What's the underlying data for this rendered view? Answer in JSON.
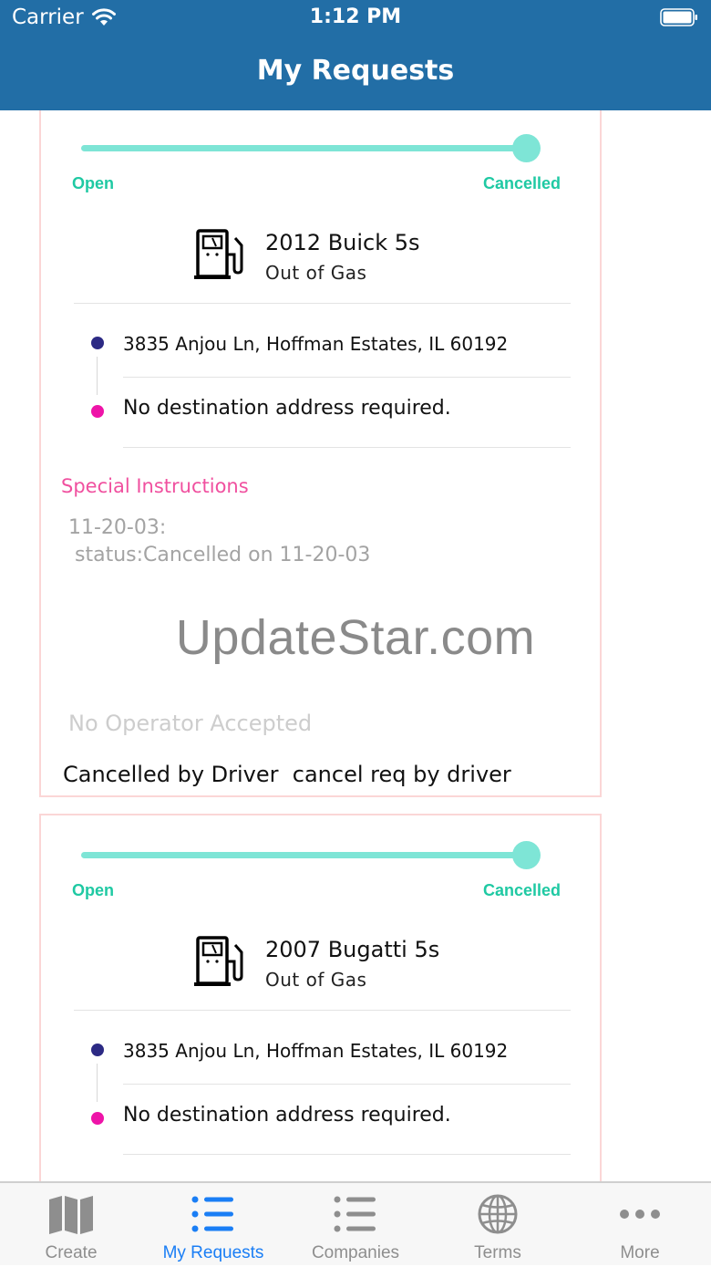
{
  "status_bar": {
    "carrier": "Carrier",
    "time": "1:12 PM"
  },
  "nav": {
    "title": "My Requests"
  },
  "requests": [
    {
      "stage_start": "Open",
      "stage_end": "Cancelled",
      "vehicle": "2012 Buick 5s",
      "service": "Out of Gas",
      "pickup_address": "3835 Anjou Ln, Hoffman Estates, IL 60192",
      "destination": "No destination address required.",
      "special_instructions_label": "Special Instructions",
      "special_instructions": "11-20-03:\n status:Cancelled on 11-20-03",
      "operator_status": "No Operator Accepted",
      "cancel_note": "Cancelled by Driver  cancel req by driver"
    },
    {
      "stage_start": "Open",
      "stage_end": "Cancelled",
      "vehicle": "2007 Bugatti 5s",
      "service": "Out of Gas",
      "pickup_address": "3835 Anjou Ln, Hoffman Estates, IL 60192",
      "destination": "No destination address required."
    }
  ],
  "watermark": "UpdateStar.com",
  "tabs": [
    {
      "label": "Create",
      "icon": "map-icon"
    },
    {
      "label": "My Requests",
      "icon": "list-icon",
      "active": true
    },
    {
      "label": "Companies",
      "icon": "list-icon"
    },
    {
      "label": "Terms",
      "icon": "globe-icon"
    },
    {
      "label": "More",
      "icon": "more-icon"
    }
  ],
  "colors": {
    "header": "#226ea6",
    "progress": "#7ee5d6",
    "stage_text": "#1fc9a3",
    "pickup_dot": "#2c2a84",
    "destination_dot": "#ee14a8",
    "special_label": "#f0509f",
    "tab_active": "#1a7ef5"
  }
}
